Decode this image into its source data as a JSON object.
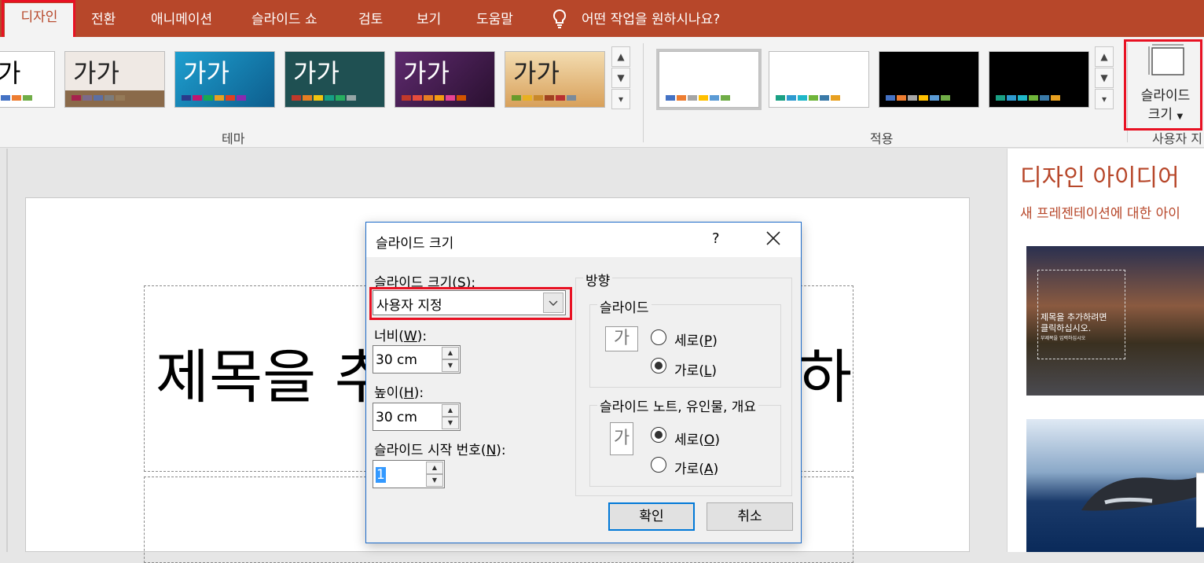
{
  "tabs": [
    {
      "label": "디자인",
      "active": true
    },
    {
      "label": "전환"
    },
    {
      "label": "애니메이션"
    },
    {
      "label": "슬라이드 쇼"
    },
    {
      "label": "검토"
    },
    {
      "label": "보기"
    },
    {
      "label": "도움말"
    }
  ],
  "tell_me": "어떤 작업을 원하시나요?",
  "ribbon": {
    "theme_group_label": "테마",
    "variants_group_label": "적용",
    "theme_sample_text": "가가",
    "partial_first_theme_text": "가",
    "slide_size_button": {
      "line1": "슬라이드",
      "line2": "크기"
    },
    "customize_group_label": "사용자 지",
    "accent_color": "#b7472a"
  },
  "slide": {
    "title_placeholder_visible": "제목을 추",
    "title_placeholder_right": "하"
  },
  "design_pane": {
    "title": "디자인 아이디어",
    "subtitle": "새 프레젠테이션에 대한 아이",
    "idea1_text_line1": "제목을 추가하려면",
    "idea1_text_line2": "클릭하십시오.",
    "idea1_text_line3": "부제목을 입력하십시오"
  },
  "dialog": {
    "title": "슬라이드 크기",
    "help": "?",
    "slide_size_label": "슬라이드 크기(",
    "slide_size_key": "S",
    "slide_size_value": "사용자 지정",
    "width_label": "너비(",
    "width_key": "W",
    "width_value": "30 cm",
    "height_label": "높이(",
    "height_key": "H",
    "height_value": "30 cm",
    "start_number_label": "슬라이드 시작 번호(",
    "start_number_key": "N",
    "start_number_value": "1",
    "orientation_label": "방향",
    "slides_group": "슬라이드",
    "notes_group": "슬라이드 노트, 유인물, 개요",
    "glyph": "가",
    "slides_portrait": "세로(",
    "slides_portrait_key": "P",
    "slides_landscape": "가로(",
    "slides_landscape_key": "L",
    "notes_portrait": "세로(",
    "notes_portrait_key": "O",
    "notes_landscape": "가로(",
    "notes_landscape_key": "A",
    "slides_selected": "landscape",
    "notes_selected": "portrait",
    "ok": "확인",
    "cancel": "취소"
  }
}
